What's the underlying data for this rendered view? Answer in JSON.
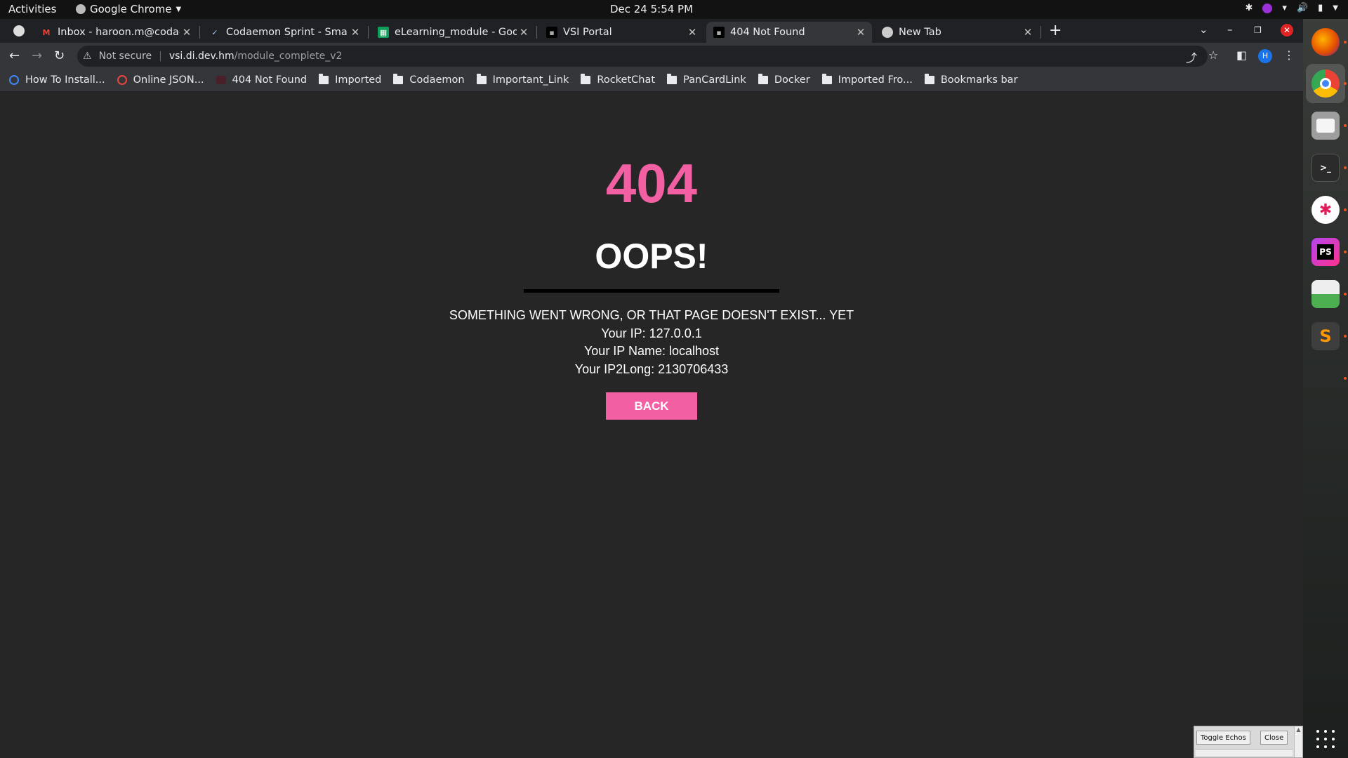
{
  "system_bar": {
    "activities": "Activities",
    "app_name": "Google Chrome",
    "clock": "Dec 24  5:54 PM"
  },
  "tabs": [
    {
      "title": "Inbox - haroon.m@codaemon",
      "icon": "gmail-icon",
      "active": false
    },
    {
      "title": "Codaemon Sprint - Smartsheet",
      "icon": "smartsheet-icon",
      "active": false
    },
    {
      "title": "eLearning_module - Google Sheets",
      "icon": "sheets-icon",
      "active": false
    },
    {
      "title": "VSI Portal",
      "icon": "vsi-icon",
      "active": false
    },
    {
      "title": "404 Not Found",
      "icon": "vsi-icon",
      "active": true
    },
    {
      "title": "New Tab",
      "icon": "chrome-icon",
      "active": false
    }
  ],
  "address_bar": {
    "security_label": "Not secure",
    "host": "vsi.di.dev.hm",
    "path": "/module_complete_v2"
  },
  "profile_initial": "H",
  "bookmarks": [
    {
      "label": "How To Install...",
      "icon": "site-icon"
    },
    {
      "label": "Online JSON...",
      "icon": "site-icon"
    },
    {
      "label": "404 Not Found",
      "icon": "site-icon"
    },
    {
      "label": "Imported",
      "icon": "folder-icon"
    },
    {
      "label": "Codaemon",
      "icon": "folder-icon"
    },
    {
      "label": "Important_Link",
      "icon": "folder-icon"
    },
    {
      "label": "RocketChat",
      "icon": "folder-icon"
    },
    {
      "label": "PanCardLink",
      "icon": "folder-icon"
    },
    {
      "label": "Docker",
      "icon": "folder-icon"
    },
    {
      "label": "Imported Fro...",
      "icon": "folder-icon"
    },
    {
      "label": "Bookmarks bar",
      "icon": "folder-icon"
    }
  ],
  "page": {
    "code": "404",
    "heading": "OOPS!",
    "message": "SOMETHING WENT WRONG, OR THAT PAGE DOESN'T EXIST... YET",
    "ip_line": "Your IP: 127.0.0.1",
    "ip_name_line": "Your IP Name: localhost",
    "ip2long_line": "Your IP2Long: 2130706433",
    "back_label": "BACK",
    "accent_color": "#f260a3"
  },
  "dock": [
    "firefox-icon",
    "chrome-icon",
    "files-icon",
    "terminal-icon",
    "slack-icon",
    "phpstorm-icon",
    "text-editor-icon",
    "sublime-icon"
  ],
  "echo_panel": {
    "toggle_label": "Toggle Echos",
    "close_label": "Close"
  }
}
